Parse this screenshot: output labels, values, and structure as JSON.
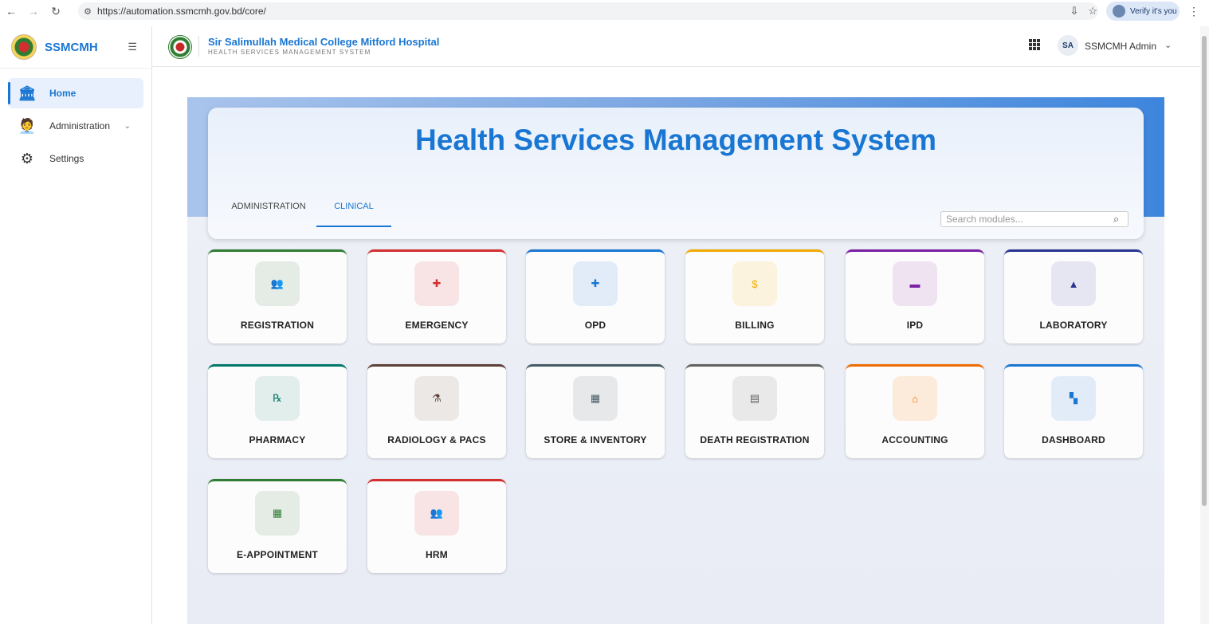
{
  "browser": {
    "url": "https://automation.ssmcmh.gov.bd/core/",
    "verify_label": "Verify it's you"
  },
  "sidebar": {
    "brand": "SSMCMH",
    "items": [
      {
        "label": "Home",
        "icon": "house-icon"
      },
      {
        "label": "Administration",
        "icon": "admin-person-icon"
      },
      {
        "label": "Settings",
        "icon": "gear-icon"
      }
    ]
  },
  "header": {
    "title": "Sir Salimullah Medical College Mitford Hospital",
    "subtitle": "HEALTH SERVICES MANAGEMENT SYSTEM",
    "avatar_initials": "SA",
    "user_name": "SSMCMH Admin"
  },
  "hero": {
    "title": "Health Services Management System",
    "tabs": [
      "ADMINISTRATION",
      "CLINICAL"
    ],
    "active_tab": "CLINICAL",
    "search_placeholder": "Search modules..."
  },
  "modules": [
    {
      "label": "REGISTRATION",
      "icon": "people-icon",
      "color": "#2e7d32",
      "bg": "#e5ece5",
      "glyph": "👥"
    },
    {
      "label": "EMERGENCY",
      "icon": "ambulance-icon",
      "color": "#d32f2f",
      "bg": "#f8e4e4",
      "glyph": "✚"
    },
    {
      "label": "OPD",
      "icon": "medical-bag-icon",
      "color": "#1976d2",
      "bg": "#e2ecf8",
      "glyph": "✚"
    },
    {
      "label": "BILLING",
      "icon": "dollar-icon",
      "color": "#f2a900",
      "bg": "#fbf3dd",
      "glyph": "$"
    },
    {
      "label": "IPD",
      "icon": "bed-icon",
      "color": "#7b1fa2",
      "bg": "#efe3f2",
      "glyph": "▬"
    },
    {
      "label": "LABORATORY",
      "icon": "flask-icon",
      "color": "#283593",
      "bg": "#e5e6f1",
      "glyph": "▲"
    },
    {
      "label": "PHARMACY",
      "icon": "medication-icon",
      "color": "#00796b",
      "bg": "#e2eeec",
      "glyph": "℞"
    },
    {
      "label": "RADIOLOGY & PACS",
      "icon": "microscope-icon",
      "color": "#5d4037",
      "bg": "#ece8e6",
      "glyph": "⚗"
    },
    {
      "label": "STORE & INVENTORY",
      "icon": "store-icon",
      "color": "#455a64",
      "bg": "#e6e8ea",
      "glyph": "▦"
    },
    {
      "label": "DEATH REGISTRATION",
      "icon": "clipboard-icon",
      "color": "#616161",
      "bg": "#e9e9e9",
      "glyph": "▤"
    },
    {
      "label": "ACCOUNTING",
      "icon": "bank-icon",
      "color": "#ef6c00",
      "bg": "#fcebda",
      "glyph": "⌂"
    },
    {
      "label": "DASHBOARD",
      "icon": "dashboard-icon",
      "color": "#1976d2",
      "bg": "#e2ecf8",
      "glyph": "▚"
    },
    {
      "label": "E-APPOINTMENT",
      "icon": "calendar-icon",
      "color": "#2e7d32",
      "bg": "#e5ece5",
      "glyph": "▦"
    },
    {
      "label": "HRM",
      "icon": "people-icon",
      "color": "#d32f2f",
      "bg": "#f8e4e4",
      "glyph": "👥"
    }
  ]
}
